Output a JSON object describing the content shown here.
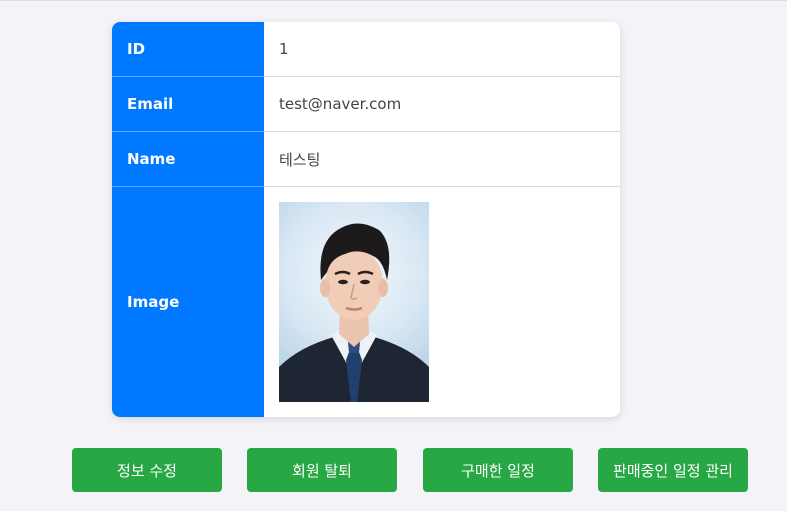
{
  "profile": {
    "id_label": "ID",
    "id_value": "1",
    "email_label": "Email",
    "email_value": "test@naver.com",
    "name_label": "Name",
    "name_value": "테스팅",
    "image_label": "Image"
  },
  "actions": {
    "edit_label": "정보 수정",
    "delete_label": "회원 탈퇴",
    "purchased_label": "구매한 일정",
    "selling_label": "판매중인 일정 관리"
  },
  "colors": {
    "label_bg": "#0078ff",
    "button_bg": "#28a745"
  }
}
